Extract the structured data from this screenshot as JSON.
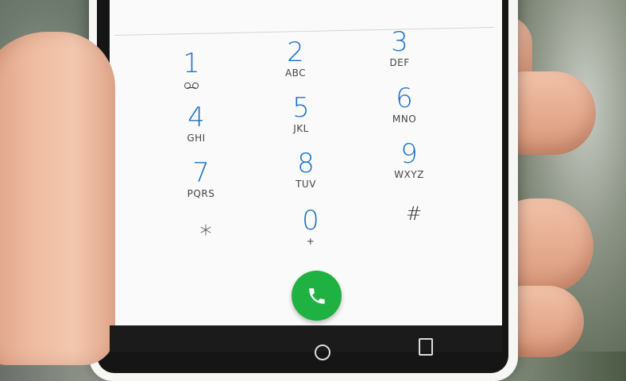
{
  "scene": {
    "description_layer": "dialer",
    "accent_color": "#1e73c8",
    "call_button_color": "#1fb141"
  },
  "dialpad": {
    "keys": [
      {
        "digit": "1",
        "letters": ""
      },
      {
        "digit": "2",
        "letters": "ABC"
      },
      {
        "digit": "3",
        "letters": "DEF"
      },
      {
        "digit": "4",
        "letters": "GHI"
      },
      {
        "digit": "5",
        "letters": "JKL"
      },
      {
        "digit": "6",
        "letters": "MNO"
      },
      {
        "digit": "7",
        "letters": "PQRS"
      },
      {
        "digit": "8",
        "letters": "TUV"
      },
      {
        "digit": "9",
        "letters": "WXYZ"
      },
      {
        "digit": "*",
        "letters": ""
      },
      {
        "digit": "0",
        "letters": "+"
      },
      {
        "digit": "#",
        "letters": ""
      }
    ]
  },
  "icons": {
    "voicemail": "voicemail-icon",
    "call": "phone-icon",
    "home": "home-circle-icon",
    "recent": "recent-apps-icon"
  }
}
